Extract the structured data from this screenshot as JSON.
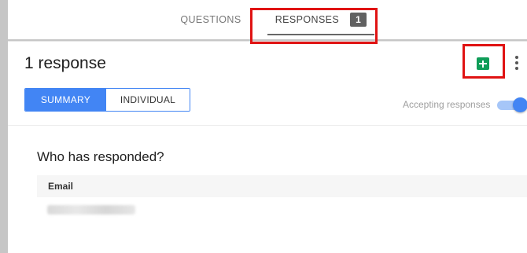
{
  "tabs": [
    {
      "label": "QUESTIONS"
    },
    {
      "label": "RESPONSES",
      "badge": "1",
      "active": true
    }
  ],
  "header": {
    "title": "1 response"
  },
  "view_toggle": {
    "summary_label": "SUMMARY",
    "individual_label": "INDIVIDUAL",
    "selected": "SUMMARY"
  },
  "accepting": {
    "label": "Accepting responses",
    "enabled": true
  },
  "respondents": {
    "title": "Who has responded?",
    "column_header": "Email"
  },
  "colors": {
    "accent": "#4285f4",
    "sheets_green": "#0f9d58",
    "highlight": "#e01313"
  },
  "icons": [
    "sheets-icon",
    "more-vert-icon"
  ]
}
